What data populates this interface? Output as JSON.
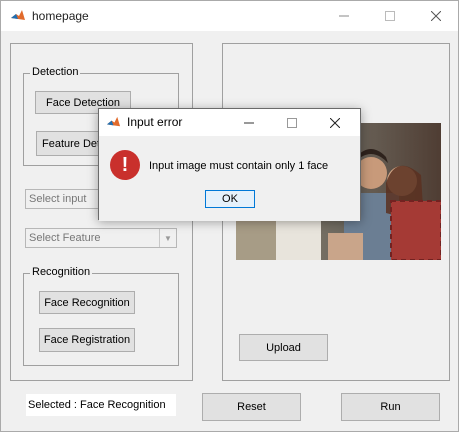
{
  "window": {
    "title": "homepage"
  },
  "detection": {
    "label": "Detection",
    "face_detection": "Face Detection",
    "feature_detection": "Feature Detection"
  },
  "select_input": {
    "value": "Select input"
  },
  "select_feature": {
    "value": "Select Feature"
  },
  "recognition": {
    "label": "Recognition",
    "face_recognition": "Face Recognition",
    "face_registration": "Face Registration"
  },
  "status": {
    "text": "Selected : Face Recognition"
  },
  "buttons": {
    "upload": "Upload",
    "reset": "Reset",
    "run": "Run"
  },
  "dialog": {
    "title": "Input error",
    "message": "Input image must contain only 1 face",
    "ok": "OK"
  },
  "colors": {
    "dialog_ok_border": "#0078d7",
    "error_icon": "#c9302c"
  }
}
